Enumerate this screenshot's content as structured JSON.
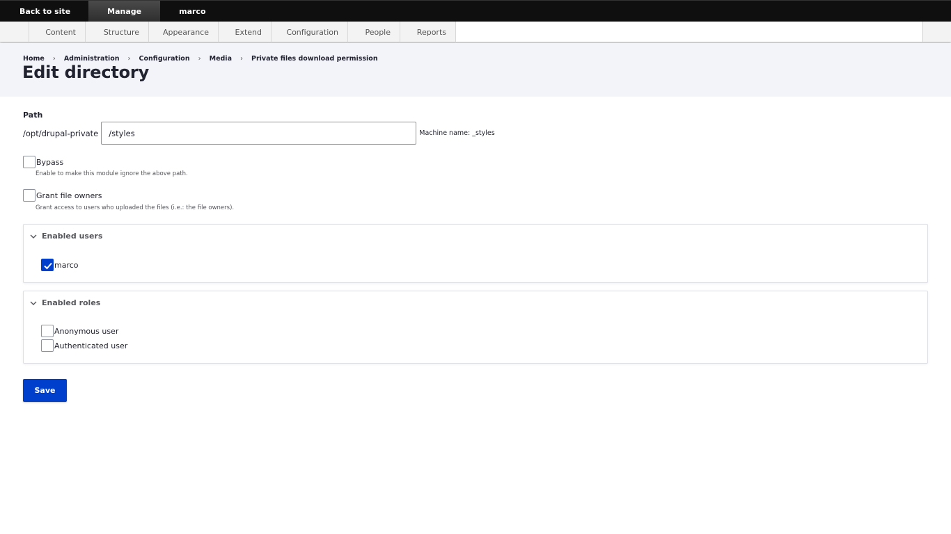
{
  "toolbar": {
    "back_to_site": "Back to site",
    "manage": "Manage",
    "user": "marco"
  },
  "tray": {
    "items": [
      "Content",
      "Structure",
      "Appearance",
      "Extend",
      "Configuration",
      "People",
      "Reports"
    ]
  },
  "breadcrumb": {
    "items": [
      "Home",
      "Administration",
      "Configuration",
      "Media",
      "Private files download permission"
    ],
    "separator": "›"
  },
  "page": {
    "title": "Edit directory"
  },
  "form": {
    "path_label": "Path",
    "path_prefix": "/opt/drupal-private",
    "path_value": "/styles",
    "machine_name": "Machine name: _styles",
    "bypass": {
      "label": "Bypass",
      "description": "Enable to make this module ignore the above path.",
      "checked": false
    },
    "grant_file_owners": {
      "label": "Grant file owners",
      "description": "Grant access to users who uploaded the files (i.e.: the file owners).",
      "checked": false
    },
    "enabled_users": {
      "title": "Enabled users",
      "options": [
        {
          "label": "marco",
          "checked": true
        }
      ]
    },
    "enabled_roles": {
      "title": "Enabled roles",
      "options": [
        {
          "label": "Anonymous user",
          "checked": false
        },
        {
          "label": "Authenticated user",
          "checked": false
        }
      ]
    },
    "save_label": "Save"
  },
  "colors": {
    "toolbar_bg": "#0f0f0f",
    "header_bg": "#f3f4f9",
    "primary": "#003ecc",
    "text": "#222330"
  }
}
